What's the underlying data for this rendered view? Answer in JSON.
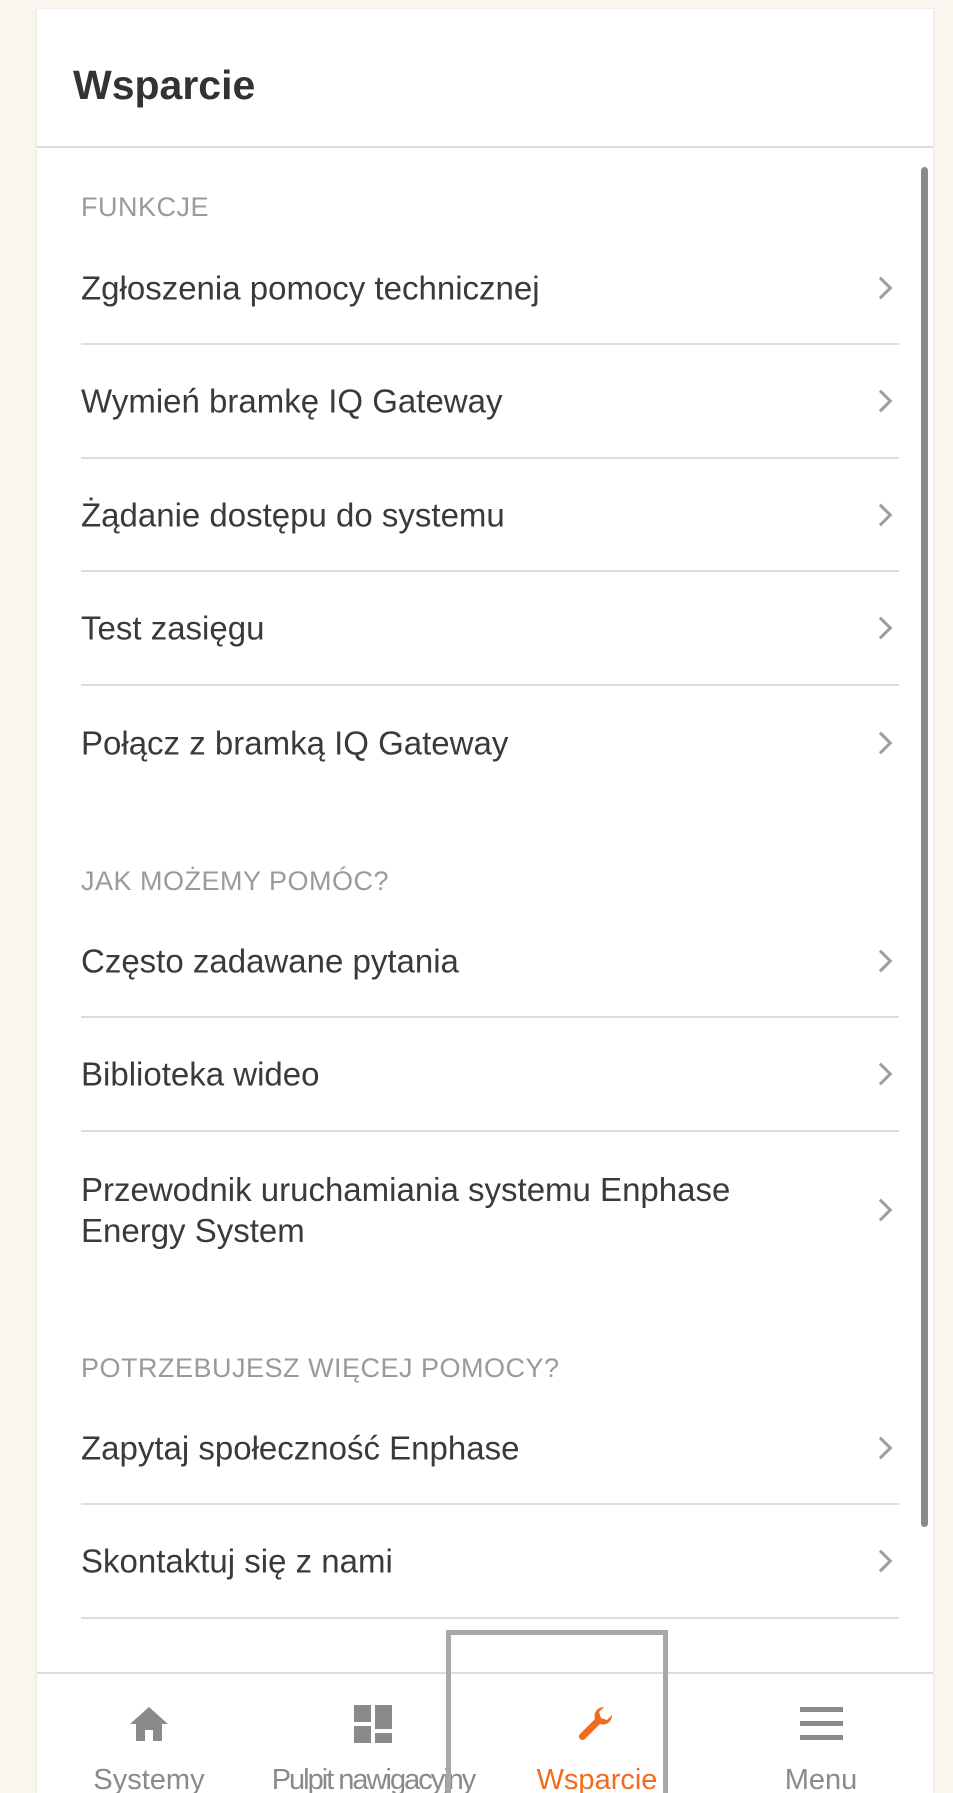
{
  "header": {
    "title": "Wsparcie"
  },
  "sections": [
    {
      "title": "FUNKCJE",
      "items": [
        {
          "label": "Zgłoszenia pomocy technicznej"
        },
        {
          "label": "Wymień bramkę IQ Gateway"
        },
        {
          "label": "Żądanie dostępu do systemu"
        },
        {
          "label": "Test zasięgu"
        },
        {
          "label": "Połącz z bramką IQ Gateway"
        }
      ]
    },
    {
      "title": "JAK MOŻEMY POMÓC?",
      "items": [
        {
          "label": "Często zadawane pytania"
        },
        {
          "label": "Biblioteka wideo"
        },
        {
          "label": "Przewodnik uruchamiania systemu Enphase Energy System"
        }
      ]
    },
    {
      "title": "POTRZEBUJESZ WIĘCEJ POMOCY?",
      "items": [
        {
          "label": "Zapytaj społeczność Enphase"
        },
        {
          "label": "Skontaktuj się z nami"
        }
      ]
    }
  ],
  "tabbar": {
    "active_tab": "Wsparcie",
    "tabs": [
      {
        "label": "Systemy",
        "icon": "home-icon"
      },
      {
        "label": "Pulpit nawigacyjny",
        "icon": "dashboard-icon"
      },
      {
        "label": "Wsparcie",
        "icon": "wrench-icon"
      },
      {
        "label": "Menu",
        "icon": "hamburger-menu-icon"
      }
    ]
  },
  "colors": {
    "accent": "#f26c1d",
    "inactive_icon": "#8a8a8a",
    "section_title": "#9a9a9a",
    "text": "#3a3a3a"
  }
}
